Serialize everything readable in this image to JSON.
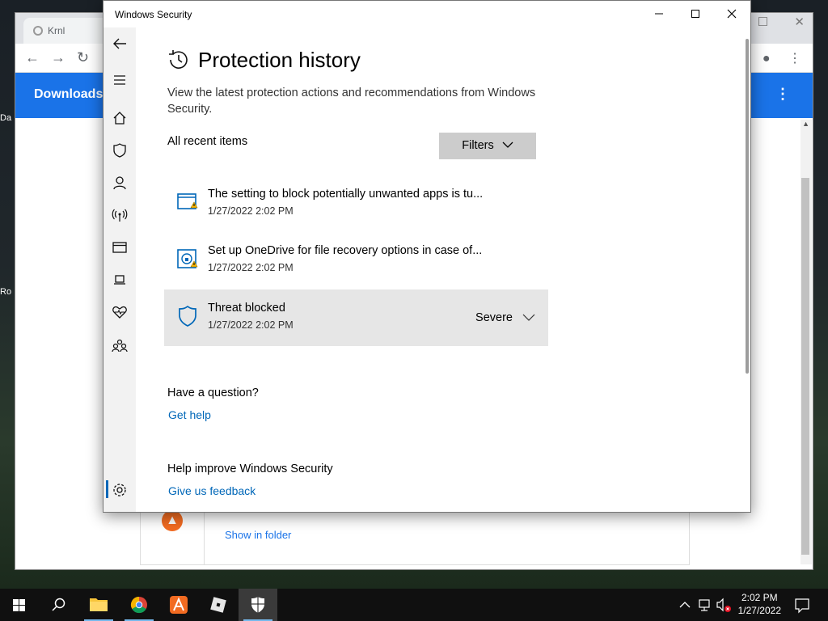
{
  "desktop": {
    "icon_labels": [
      "Da",
      "Ro"
    ]
  },
  "browser": {
    "tab_title": "Krnl",
    "page_header": "Downloads",
    "download_link": "Show in folder"
  },
  "security": {
    "window_title": "Windows Security",
    "page_title": "Protection history",
    "description": "View the latest protection actions and recommendations from Windows Security.",
    "recent_label": "All recent items",
    "filters_label": "Filters",
    "items": [
      {
        "title": "The setting to block potentially unwanted apps is tu...",
        "date": "1/27/2022 2:02 PM",
        "icon": "app-browser-warning-icon"
      },
      {
        "title": "Set up OneDrive for file recovery options in case of...",
        "date": "1/27/2022 2:02 PM",
        "icon": "ransomware-warning-icon"
      },
      {
        "title": "Threat blocked",
        "date": "1/27/2022 2:02 PM",
        "severity": "Severe",
        "icon": "shield-icon"
      }
    ],
    "question_title": "Have a question?",
    "get_help": "Get help",
    "improve_title": "Help improve Windows Security",
    "feedback": "Give us feedback"
  },
  "taskbar": {
    "time": "2:02 PM",
    "date": "1/27/2022"
  },
  "colors": {
    "accent": "#0067b8",
    "chrome_blue": "#1a73e8",
    "taskbar": "#101010"
  }
}
